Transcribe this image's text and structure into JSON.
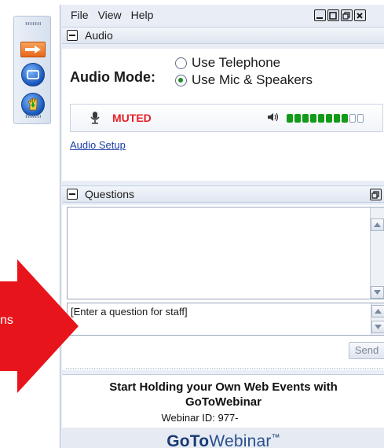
{
  "menu": [
    "File",
    "View",
    "Help"
  ],
  "audio": {
    "section_title": "Audio",
    "mode_label": "Audio Mode:",
    "options": [
      "Use Telephone",
      "Use Mic & Speakers"
    ],
    "selected": "Use Mic & Speakers",
    "status": "MUTED",
    "meter_level": "8 of 10",
    "setup_link": "Audio Setup"
  },
  "questions": {
    "section_title": "Questions",
    "input_value": "[Enter a question for staff]",
    "send_label": "Send"
  },
  "promo": {
    "line1": "Start Holding your Own Web Events with",
    "line2": "GoToWebinar",
    "webinar_id": "Webinar ID: 977-",
    "logo_bold": "GoTo",
    "logo_light": "Webinar",
    "logo_mark": "™"
  },
  "annotation": {
    "arrow_text": "ns"
  },
  "colors": {
    "muted_red": "#e8202a",
    "meter_green": "#129b18",
    "arrow_red": "#e8141b",
    "link_blue": "#1b3fa6"
  }
}
